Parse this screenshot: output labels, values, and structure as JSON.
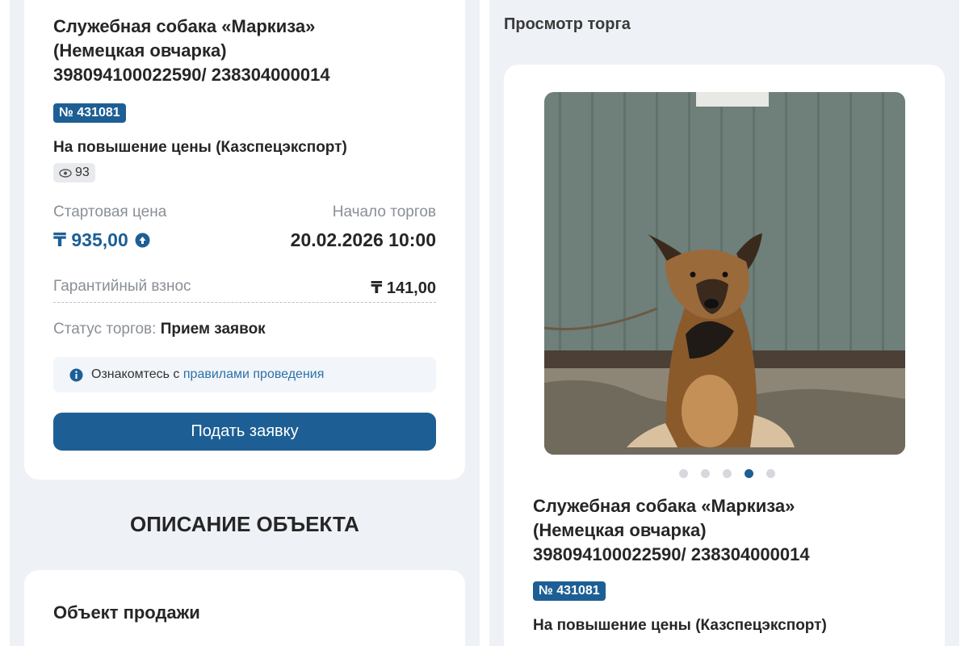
{
  "left": {
    "lot_title_line1": "Служебная собака «Маркиза»",
    "lot_title_line2": "(Немецкая овчарка)",
    "lot_title_line3": "398094100022590/ 238304000014",
    "lot_number": "№ 431081",
    "auction_type": "На повышение цены (Казспецэкспорт)",
    "views": "93",
    "start_price_label": "Стартовая цена",
    "start_price": "₸ 935,00",
    "start_time_label": "Начало торгов",
    "start_time": "20.02.2026 10:00",
    "deposit_label": "Гарантийный взнос",
    "deposit": "₸ 141,00",
    "status_label": "Статус торгов:",
    "status_value": "Прием заявок",
    "rules_prefix": "Ознакомтесь с",
    "rules_link": "правилами проведения",
    "apply_button": "Подать заявку",
    "section_heading": "ОПИСАНИЕ ОБЪЕКТА",
    "object_heading": "Объект продажи"
  },
  "right": {
    "page_title": "Просмотр торга",
    "gallery_count": 5,
    "gallery_active_index": 3,
    "lot_title_line1": "Служебная собака «Маркиза»",
    "lot_title_line2": "(Немецкая овчарка)",
    "lot_title_line3": "398094100022590/ 238304000014",
    "lot_number": "№ 431081",
    "auction_type": "На повышение цены (Казспецэкспорт)"
  },
  "colors": {
    "accent": "#1d5f95",
    "panel_bg": "#eef2f6",
    "link": "#2b72a8"
  },
  "icons": {
    "views": "eye-icon",
    "price_raise": "arrow-up-circle-icon",
    "info": "info-icon"
  }
}
